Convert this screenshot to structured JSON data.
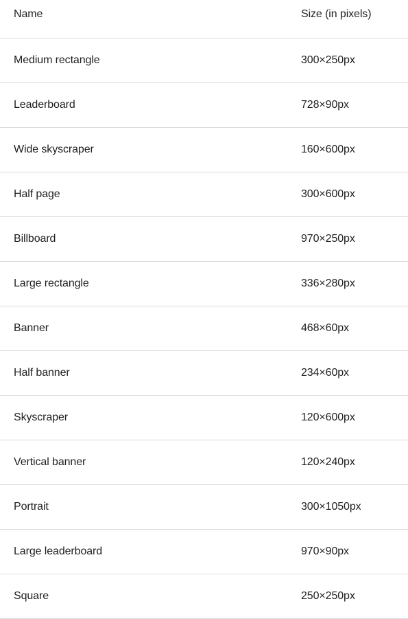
{
  "table": {
    "headers": {
      "name": "Name",
      "size": "Size (in pixels)"
    },
    "rows": [
      {
        "name": "Medium rectangle",
        "size": "300×250px"
      },
      {
        "name": "Leaderboard",
        "size": "728×90px"
      },
      {
        "name": "Wide skyscraper",
        "size": "160×600px"
      },
      {
        "name": "Half page",
        "size": "300×600px"
      },
      {
        "name": "Billboard",
        "size": "970×250px"
      },
      {
        "name": "Large rectangle",
        "size": "336×280px"
      },
      {
        "name": "Banner",
        "size": "468×60px"
      },
      {
        "name": "Half banner",
        "size": "234×60px"
      },
      {
        "name": "Skyscraper",
        "size": "120×600px"
      },
      {
        "name": "Vertical banner",
        "size": "120×240px"
      },
      {
        "name": "Portrait",
        "size": "300×1050px"
      },
      {
        "name": "Large leaderboard",
        "size": "970×90px"
      },
      {
        "name": "Square",
        "size": "250×250px"
      }
    ]
  }
}
